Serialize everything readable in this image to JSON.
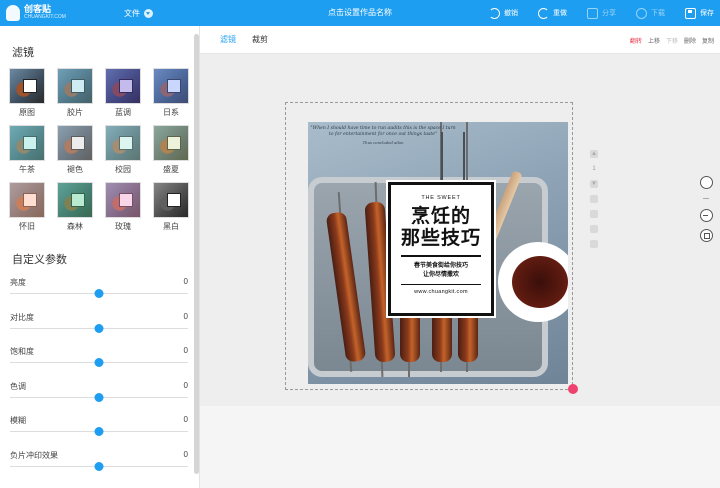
{
  "topbar": {
    "logo_title": "创客贴",
    "logo_sub": "CHUANGKIT.COM",
    "file_label": "文件",
    "doc_title": "点击设置作品名称",
    "actions": [
      {
        "label": "撤销",
        "icon": "undo-icon",
        "enabled": true
      },
      {
        "label": "重做",
        "icon": "redo-icon",
        "enabled": true
      },
      {
        "label": "分享",
        "icon": "share-icon",
        "enabled": false
      },
      {
        "label": "下载",
        "icon": "download-icon",
        "enabled": false
      },
      {
        "label": "保存",
        "icon": "save-icon",
        "enabled": true
      }
    ]
  },
  "left_panel": {
    "filters_title": "滤镜",
    "filters": [
      {
        "label": "原图",
        "tint": "rgba(0,0,0,0)"
      },
      {
        "label": "胶片",
        "tint": "rgba(120,200,220,0.35)"
      },
      {
        "label": "蓝调",
        "tint": "rgba(80,60,200,0.35)"
      },
      {
        "label": "日系",
        "tint": "rgba(100,140,255,0.35)"
      },
      {
        "label": "午茶",
        "tint": "rgba(120,220,210,0.40)"
      },
      {
        "label": "褪色",
        "tint": "rgba(200,200,200,0.35)"
      },
      {
        "label": "校园",
        "tint": "rgba(170,230,220,0.40)"
      },
      {
        "label": "盛夏",
        "tint": "rgba(200,220,150,0.35)"
      },
      {
        "label": "怀旧",
        "tint": "rgba(255,180,150,0.45)"
      },
      {
        "label": "森林",
        "tint": "rgba(80,200,140,0.40)"
      },
      {
        "label": "玫瑰",
        "tint": "rgba(240,150,200,0.40)"
      },
      {
        "label": "黑白",
        "tint": "grayscale"
      }
    ],
    "custom_title": "自定义参数",
    "params": [
      {
        "label": "亮度",
        "value": "0",
        "level": 0.5
      },
      {
        "label": "对比度",
        "value": "0",
        "level": 0.5
      },
      {
        "label": "饱和度",
        "value": "0",
        "level": 0.5
      },
      {
        "label": "色调",
        "value": "0",
        "level": 0.5
      },
      {
        "label": "模糊",
        "value": "0",
        "level": 0.5
      },
      {
        "label": "负片冲印效果",
        "value": "0",
        "level": 0.5
      }
    ]
  },
  "editor": {
    "tabs": [
      {
        "label": "滤镜",
        "active": true
      },
      {
        "label": "裁剪",
        "active": false
      }
    ],
    "right_tools": [
      {
        "label": "翻转",
        "style": "red"
      },
      {
        "label": "上移",
        "style": "normal"
      },
      {
        "label": "下移",
        "style": "dim"
      },
      {
        "label": "删除",
        "style": "normal"
      },
      {
        "label": "复制",
        "style": "normal"
      }
    ],
    "layer_page": "1"
  },
  "design": {
    "quote": "\"When I should have time to run audits this is the space I turn to for entertainment for once out things taste\"",
    "quote_by": "Thus concluded ailoo",
    "card_top": "THE SWEET",
    "card_title_1": "烹饪的",
    "card_title_2": "那些技巧",
    "card_sub_1": "春节美食街给你技巧",
    "card_sub_2": "让你尽情撒欢",
    "card_web": "www.chuangkit.com"
  },
  "colors": {
    "accent": "#1e9ef0",
    "handle": "#f0426e"
  }
}
